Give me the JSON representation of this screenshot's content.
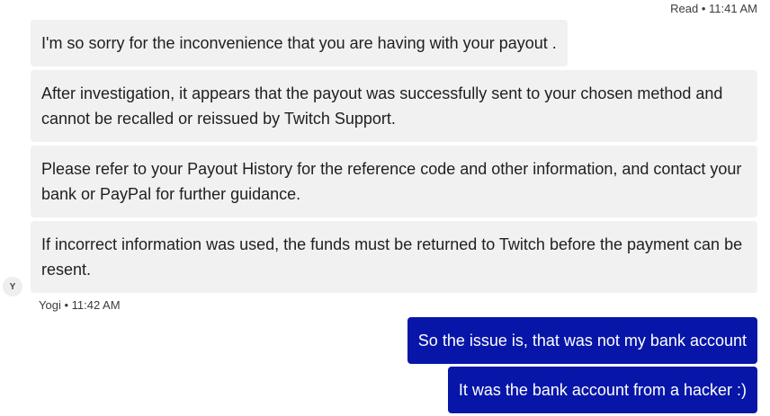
{
  "read_receipt": "Read • 11:41 AM",
  "incoming": {
    "sender_initial": "Y",
    "sender_meta": "Yogi • 11:42 AM",
    "messages": [
      "I'm so sorry for the inconvenience that you are having with your payout .",
      "After investigation, it appears that the payout was successfully sent to your chosen method and cannot be recalled or reissued by Twitch Support.",
      "Please refer to your Payout History for the reference code and other information, and contact your bank or PayPal for further guidance.",
      "If incorrect information was used, the funds must be returned to Twitch before the payment can be resent."
    ]
  },
  "outgoing": {
    "messages": [
      "So the issue is, that was not my bank account",
      "It was the bank account from a hacker :)"
    ]
  },
  "colors": {
    "incoming_bubble": "#f1f1f1",
    "outgoing_bubble": "#0716a8"
  }
}
